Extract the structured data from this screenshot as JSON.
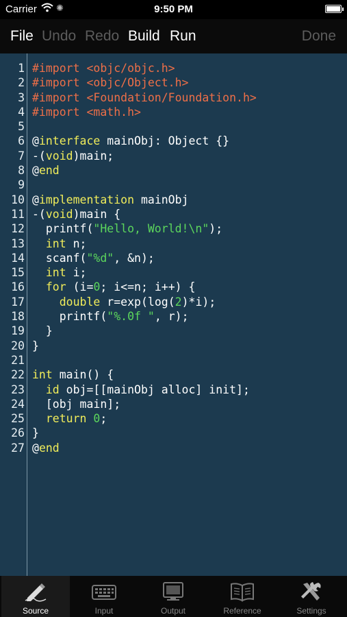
{
  "status_bar": {
    "carrier": "Carrier",
    "time": "9:50 PM"
  },
  "toolbar": {
    "file": "File",
    "undo": "Undo",
    "redo": "Redo",
    "build": "Build",
    "run": "Run",
    "done": "Done"
  },
  "colors": {
    "keyword": "#f0ec5a",
    "preprocessor": "#ee6f48",
    "string": "#5cd65c",
    "number": "#5cd65c",
    "plain": "#ffffff",
    "background": "#1c3a4f"
  },
  "code_lines": [
    [
      {
        "t": "#import <objc/objc.h>",
        "c": "preprocessor"
      }
    ],
    [
      {
        "t": "#import <objc/Object.h>",
        "c": "preprocessor"
      }
    ],
    [
      {
        "t": "#import <Foundation/Foundation.h>",
        "c": "preprocessor"
      }
    ],
    [
      {
        "t": "#import <math.h>",
        "c": "preprocessor"
      }
    ],
    [],
    [
      {
        "t": "@",
        "c": "plain"
      },
      {
        "t": "interface",
        "c": "keyword"
      },
      {
        "t": " mainObj: Object {}",
        "c": "plain"
      }
    ],
    [
      {
        "t": "-(",
        "c": "plain"
      },
      {
        "t": "void",
        "c": "keyword"
      },
      {
        "t": ")main;",
        "c": "plain"
      }
    ],
    [
      {
        "t": "@",
        "c": "plain"
      },
      {
        "t": "end",
        "c": "keyword"
      }
    ],
    [],
    [
      {
        "t": "@",
        "c": "plain"
      },
      {
        "t": "implementation",
        "c": "keyword"
      },
      {
        "t": " mainObj",
        "c": "plain"
      }
    ],
    [
      {
        "t": "-(",
        "c": "plain"
      },
      {
        "t": "void",
        "c": "keyword"
      },
      {
        "t": ")main {",
        "c": "plain"
      }
    ],
    [
      {
        "t": "  printf(",
        "c": "plain"
      },
      {
        "t": "\"Hello, World!\\n\"",
        "c": "string"
      },
      {
        "t": ");",
        "c": "plain"
      }
    ],
    [
      {
        "t": "  ",
        "c": "plain"
      },
      {
        "t": "int",
        "c": "keyword"
      },
      {
        "t": " n;",
        "c": "plain"
      }
    ],
    [
      {
        "t": "  scanf(",
        "c": "plain"
      },
      {
        "t": "\"%d\"",
        "c": "string"
      },
      {
        "t": ", &n);",
        "c": "plain"
      }
    ],
    [
      {
        "t": "  ",
        "c": "plain"
      },
      {
        "t": "int",
        "c": "keyword"
      },
      {
        "t": " i;",
        "c": "plain"
      }
    ],
    [
      {
        "t": "  ",
        "c": "plain"
      },
      {
        "t": "for",
        "c": "keyword"
      },
      {
        "t": " (i=",
        "c": "plain"
      },
      {
        "t": "0",
        "c": "number"
      },
      {
        "t": "; i<=n; i++) {",
        "c": "plain"
      }
    ],
    [
      {
        "t": "    ",
        "c": "plain"
      },
      {
        "t": "double",
        "c": "keyword"
      },
      {
        "t": " r=exp(log(",
        "c": "plain"
      },
      {
        "t": "2",
        "c": "number"
      },
      {
        "t": ")*i);",
        "c": "plain"
      }
    ],
    [
      {
        "t": "    printf(",
        "c": "plain"
      },
      {
        "t": "\"%.0f \"",
        "c": "string"
      },
      {
        "t": ", r);",
        "c": "plain"
      }
    ],
    [
      {
        "t": "  }",
        "c": "plain"
      }
    ],
    [
      {
        "t": "}",
        "c": "plain"
      }
    ],
    [],
    [
      {
        "t": "int",
        "c": "keyword"
      },
      {
        "t": " main() {",
        "c": "plain"
      }
    ],
    [
      {
        "t": "  ",
        "c": "plain"
      },
      {
        "t": "id",
        "c": "keyword"
      },
      {
        "t": " obj=[[mainObj alloc] init];",
        "c": "plain"
      }
    ],
    [
      {
        "t": "  [obj main];",
        "c": "plain"
      }
    ],
    [
      {
        "t": "  ",
        "c": "plain"
      },
      {
        "t": "return",
        "c": "keyword"
      },
      {
        "t": " ",
        "c": "plain"
      },
      {
        "t": "0",
        "c": "number"
      },
      {
        "t": ";",
        "c": "plain"
      }
    ],
    [
      {
        "t": "}",
        "c": "plain"
      }
    ],
    [
      {
        "t": "@",
        "c": "plain"
      },
      {
        "t": "end",
        "c": "keyword"
      }
    ]
  ],
  "tabs": [
    {
      "label": "Source",
      "icon": "pencil-icon",
      "active": true
    },
    {
      "label": "Input",
      "icon": "keyboard-icon",
      "active": false
    },
    {
      "label": "Output",
      "icon": "monitor-icon",
      "active": false
    },
    {
      "label": "Reference",
      "icon": "book-icon",
      "active": false
    },
    {
      "label": "Settings",
      "icon": "tools-icon",
      "active": false
    }
  ]
}
